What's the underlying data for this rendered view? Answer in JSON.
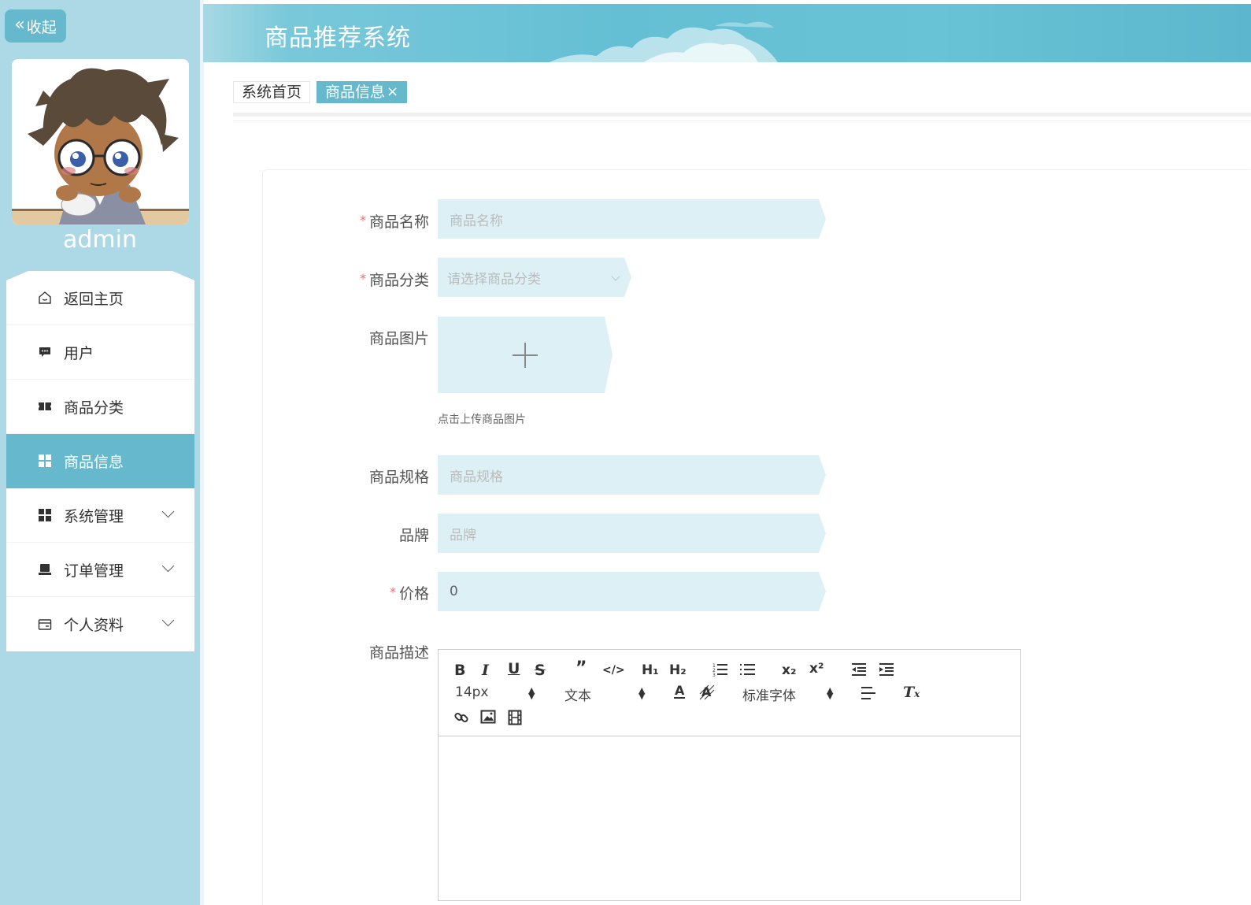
{
  "app": {
    "title": "商品推荐系统",
    "collapse_label": "收起",
    "username": "admin"
  },
  "sidebar": {
    "items": [
      {
        "label": "返回主页",
        "icon": "home-icon",
        "active": false,
        "has_arrow": false
      },
      {
        "label": "用户",
        "icon": "chat-icon",
        "active": false,
        "has_arrow": false
      },
      {
        "label": "商品分类",
        "icon": "ticket-icon",
        "active": false,
        "has_arrow": false
      },
      {
        "label": "商品信息",
        "icon": "grid-icon",
        "active": true,
        "has_arrow": false
      },
      {
        "label": "系统管理",
        "icon": "grid-icon",
        "active": false,
        "has_arrow": true
      },
      {
        "label": "订单管理",
        "icon": "monitor-icon",
        "active": false,
        "has_arrow": true
      },
      {
        "label": "个人资料",
        "icon": "card-icon",
        "active": false,
        "has_arrow": true
      }
    ]
  },
  "tabs": [
    {
      "label": "系统首页",
      "active": false
    },
    {
      "label": "商品信息",
      "close": "×",
      "active": true
    }
  ],
  "form": {
    "name": {
      "label": "商品名称",
      "required": "*",
      "placeholder": "商品名称"
    },
    "category": {
      "label": "商品分类",
      "required": "*",
      "placeholder": "请选择商品分类"
    },
    "image": {
      "label": "商品图片",
      "tip": "点击上传商品图片"
    },
    "spec": {
      "label": "商品规格",
      "placeholder": "商品规格"
    },
    "brand": {
      "label": "品牌",
      "placeholder": "品牌"
    },
    "price": {
      "label": "价格",
      "required": "*",
      "value": "0"
    },
    "description": {
      "label": "商品描述"
    }
  },
  "editor": {
    "font_size": "14px",
    "header": "文本",
    "font_family": "标准字体",
    "sub_label": "x₂",
    "sup_label": "x²",
    "h1_label": "H₁",
    "h2_label": "H₂"
  },
  "colors": {
    "accent": "#66b9cd",
    "sidebar_bg": "#add8e6",
    "input_bg": "#ddf0f5",
    "required": "#f56c6c"
  }
}
